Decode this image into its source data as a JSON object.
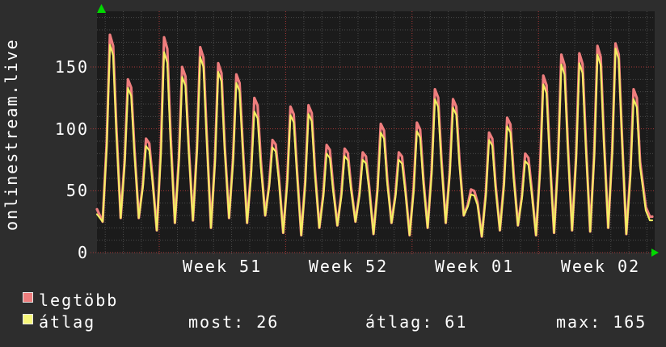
{
  "title": "onlinestream.live",
  "y_axis_ticks": [
    "0",
    "50",
    "100",
    "150"
  ],
  "week_labels": [
    "Week 51",
    "Week 52",
    "Week 01",
    "Week 02"
  ],
  "legend": {
    "items": [
      {
        "label": "legtöbb",
        "color": "#ee7d7d"
      },
      {
        "label": "átlag",
        "color": "#f6f67a"
      }
    ],
    "stats": [
      {
        "text": "most: 26"
      },
      {
        "text": "átlag: 61"
      },
      {
        "text": "max: 165"
      }
    ]
  },
  "colors": {
    "page_background": "#2d2d2d",
    "plot_background": "#1b1b1b",
    "minor_grid": "#4b4b4b",
    "major_grid": "#a83838",
    "text": "#ffffff",
    "axis_arrow": "#00d900",
    "series_max": "#ee7d7d",
    "series_avg": "#f2ee62"
  },
  "chart_data": {
    "type": "line",
    "title": "onlinestream.live",
    "x_axis": {
      "tick_labels": [
        "Week 51",
        "Week 52",
        "Week 01",
        "Week 02"
      ],
      "minor_grid_step": "1 day",
      "major_grid_step": "1 week",
      "span_days": 31
    },
    "y_axis": {
      "tick_values": [
        0,
        50,
        100,
        150
      ],
      "range": [
        0,
        195
      ],
      "minor_grid_step": 10
    },
    "series": [
      {
        "name": "legtöbb",
        "color": "#ee7d7d",
        "entry_value": 35,
        "end_value": 29,
        "daily_peaks": [
          176,
          140,
          92,
          174,
          150,
          166,
          153,
          144,
          125,
          91,
          118,
          119,
          87,
          84,
          81,
          104,
          81,
          105,
          132,
          124,
          51,
          97,
          109,
          80,
          143,
          160,
          161,
          167,
          169,
          132
        ]
      },
      {
        "name": "átlag",
        "color": "#f2ee62",
        "entry_value": 31,
        "end_value": 26,
        "daily_peaks": [
          168,
          133,
          86,
          162,
          142,
          158,
          146,
          137,
          114,
          85,
          111,
          112,
          80,
          78,
          75,
          97,
          75,
          98,
          124,
          117,
          47,
          91,
          102,
          74,
          136,
          152,
          153,
          160,
          165,
          124
        ]
      }
    ],
    "daily_troughs": [
      25,
      28,
      28,
      18,
      24,
      26,
      20,
      28,
      24,
      30,
      16,
      14,
      20,
      22,
      25,
      15,
      24,
      14,
      20,
      24,
      30,
      13,
      18,
      22,
      14,
      16,
      18,
      17,
      20,
      15
    ],
    "stats": {
      "most": 26,
      "atlag": 61,
      "max": 165
    },
    "legend_position": "bottom",
    "grid": "dotted"
  }
}
